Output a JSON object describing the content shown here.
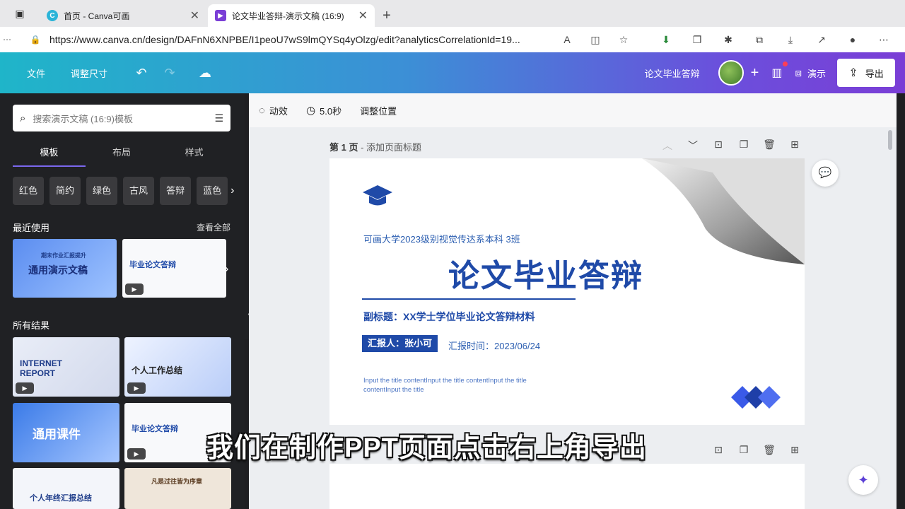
{
  "browser": {
    "tabs": [
      {
        "label": "首页 - Canva可画",
        "close": "✕"
      },
      {
        "label": "论文毕业答辩-演示文稿 (16:9)",
        "close": "✕"
      }
    ],
    "new_tab": "+",
    "url": "https://www.canva.cn/design/DAFnN6XNPBE/I1peoU7wS9lmQYSq4yOlzg/edit?analyticsCorrelationId=19..."
  },
  "appbar": {
    "menu_file": "文件",
    "menu_resize": "调整尺寸",
    "doc_title": "论文毕业答辩",
    "add": "+",
    "present": "演示",
    "export": "导出"
  },
  "left_panel": {
    "search_placeholder": "搜索演示文稿 (16:9)模板",
    "tabs": [
      "模板",
      "布局",
      "样式"
    ],
    "chips": [
      "红色",
      "简约",
      "绿色",
      "古风",
      "答辩",
      "蓝色"
    ],
    "recent_title": "最近使用",
    "view_all": "查看全部",
    "recent": [
      {
        "small": "期末作业汇报提升",
        "title": "通用演示文稿"
      },
      {
        "title": "毕业论文答辩"
      }
    ],
    "all_title": "所有结果",
    "results": [
      {
        "title": "INTERNET REPORT"
      },
      {
        "title": "个人工作总结"
      },
      {
        "title": "通用课件"
      },
      {
        "title": "毕业论文答辩"
      },
      {
        "title": "个人年终汇报总结"
      },
      {
        "title": "凡是过往皆为序章"
      }
    ]
  },
  "context_bar": {
    "animate": "动效",
    "duration": "5.0秒",
    "position": "调整位置"
  },
  "page": {
    "label": "第 1 页",
    "sub": " - 添加页面标题"
  },
  "slide": {
    "school": "可画大学2023级别视觉传达系本科 3班",
    "title": "论文毕业答辩",
    "subtitle": "副标题：XX学士学位毕业论文答辩材料",
    "reporter": "汇报人：张小可",
    "time": "汇报时间：2023/06/24",
    "filler": "Input the title contentInput the title contentInput the title contentInput the title"
  },
  "caption": "我们在制作PPT页面点击右上角导出",
  "colors": {
    "accent": "#1f4aa8",
    "panel": "#202124"
  }
}
